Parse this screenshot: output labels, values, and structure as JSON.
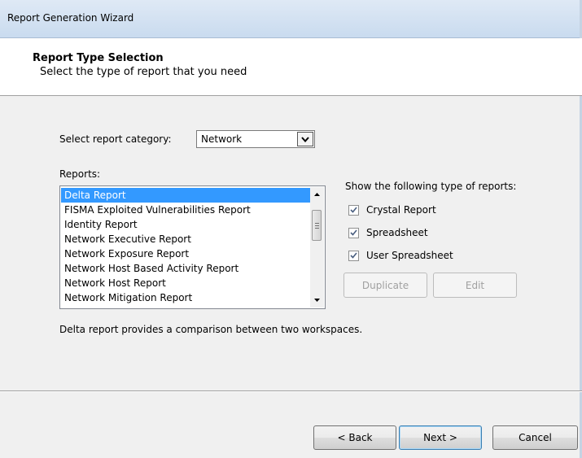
{
  "window": {
    "title": "Report Generation Wizard"
  },
  "header": {
    "title": "Report Type Selection",
    "subtitle": "Select the type of report that you need"
  },
  "category": {
    "label": "Select report category:",
    "selected": "Network"
  },
  "reports": {
    "label": "Reports:",
    "items": [
      {
        "label": "Delta Report",
        "selected": true
      },
      {
        "label": "FISMA Exploited Vulnerabilities Report"
      },
      {
        "label": "Identity Report"
      },
      {
        "label": "Network Executive Report"
      },
      {
        "label": "Network Exposure Report"
      },
      {
        "label": "Network Host Based Activity Report"
      },
      {
        "label": "Network Host Report"
      },
      {
        "label": "Network Mitigation Report"
      }
    ],
    "description": "Delta report provides a comparison between two workspaces."
  },
  "filters": {
    "label": "Show the following type of reports:",
    "options": [
      {
        "label": "Crystal Report",
        "checked": true
      },
      {
        "label": "Spreadsheet",
        "checked": true
      },
      {
        "label": "User Spreadsheet",
        "checked": true
      }
    ]
  },
  "actions": {
    "duplicate": "Duplicate",
    "edit": "Edit"
  },
  "nav": {
    "back": "< Back",
    "next": "Next >",
    "cancel": "Cancel"
  }
}
